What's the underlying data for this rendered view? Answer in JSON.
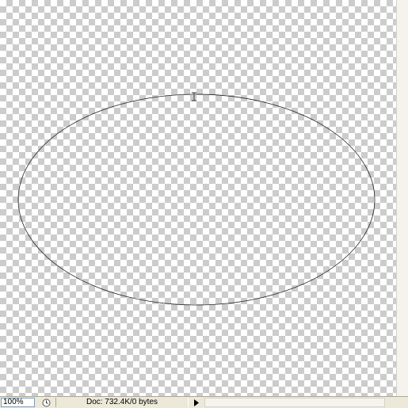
{
  "canvas": {
    "background": "transparent-checkerboard",
    "shape": "ellipse-path",
    "stroke_color": "#222222",
    "cursor": "i-beam-cursor"
  },
  "statusbar": {
    "zoom": "100%",
    "doc_info": "Doc: 732.4K/0 bytes",
    "menu_arrow_icon": "right-triangle-icon",
    "clock_icon": "clock-icon"
  }
}
